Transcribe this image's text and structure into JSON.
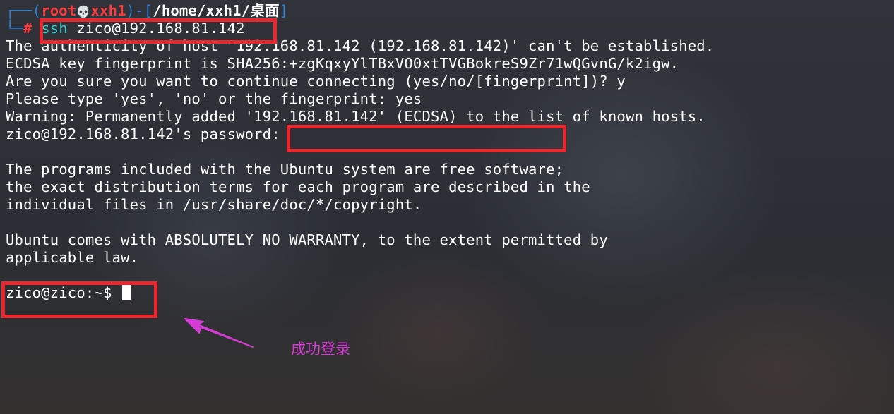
{
  "terminal": {
    "prompt": {
      "frame_top": "┌──",
      "frame_bottom": "└─",
      "open": "(",
      "user": "root",
      "skull": "💀",
      "host": "xxh1",
      "close_sep": ")-[",
      "cwd": "/home/xxh1/桌面",
      "close": "]",
      "hash": "#",
      "cmd_name": "ssh",
      "cmd_args": " zico@192.168.81.142"
    },
    "lines": [
      "The authenticity of host '192.168.81.142 (192.168.81.142)' can't be established.",
      "ECDSA key fingerprint is SHA256:+zgKqxyYlTBxVO0xtTVGBokreS9Zr71wQGvnG/k2igw.",
      "Are you sure you want to continue connecting (yes/no/[fingerprint])? y",
      "Please type 'yes', 'no' or the fingerprint: yes",
      "Warning: Permanently added '192.168.81.142' (ECDSA) to the list of known hosts.",
      "zico@192.168.81.142's password:"
    ],
    "motd": [
      "The programs included with the Ubuntu system are free software;",
      "the exact distribution terms for each program are described in the",
      "individual files in /usr/share/doc/*/copyright."
    ],
    "warranty": [
      "Ubuntu comes with ABSOLUTELY NO WARRANTY, to the extent permitted by",
      "applicable law."
    ],
    "remote_prompt": "zico@zico:~$ "
  },
  "annotation": {
    "label": "成功登录",
    "box_color": "#e8272f",
    "label_color": "#d63bd6"
  }
}
